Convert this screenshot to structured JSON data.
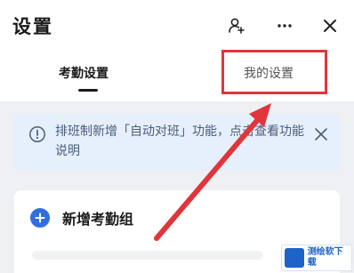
{
  "header": {
    "title": "设置",
    "icons": [
      "add-person-icon",
      "more-icon",
      "close-icon"
    ]
  },
  "tabs": [
    {
      "label": "考勤设置",
      "active": true
    },
    {
      "label": "我的设置",
      "active": false
    }
  ],
  "notice": {
    "text": "排班制新增「自动对班」功能，点击查看功能说明",
    "icon": "info-circle-icon"
  },
  "card": {
    "add_label": "新增考勤组",
    "icon": "plus-circle-icon"
  },
  "watermark": {
    "text": "测绘软下载"
  },
  "colors": {
    "highlight": "#e0353a",
    "accent": "#2f6fe0",
    "notice_bg": "#e6f0fd",
    "content_bg": "#eef0f4"
  }
}
